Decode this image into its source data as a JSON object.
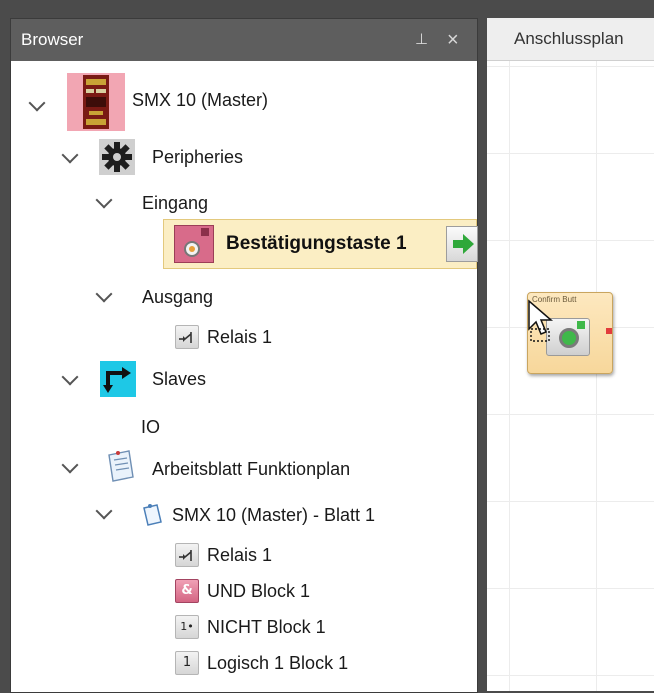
{
  "browser": {
    "title": "Browser",
    "pin_glyph": "⊥",
    "close_glyph": "×"
  },
  "tree": {
    "master": "SMX 10 (Master)",
    "peripheries": "Peripheries",
    "eingang": "Eingang",
    "bestaetigungstaste": "Bestätigungstaste 1",
    "ausgang": "Ausgang",
    "relais_out": "Relais 1",
    "slaves": "Slaves",
    "io": "IO",
    "arbeitsblatt": "Arbeitsblatt Funktionplan",
    "blatt": "SMX 10 (Master) - Blatt 1",
    "relais_blatt": "Relais 1",
    "und_block": "UND Block 1",
    "und_glyph": "&",
    "nicht_block": "NICHT Block 1",
    "nicht_glyph": "1•",
    "logisch_block": "Logisch 1 Block 1",
    "logisch_glyph": "1"
  },
  "right_panel": {
    "tab_label": "Anschlussplan",
    "block_label": "Confirm Butt"
  },
  "colors": {
    "header_bg": "#5e5e5e",
    "selection_bg": "#fbeec4",
    "slaves_icon": "#1ec8e6",
    "master_icon": "#f2a6b3",
    "arrow_green": "#2fa83a"
  },
  "icons": {
    "master": "device-board-icon",
    "peripheries": "gear-icon",
    "button": "pushbutton-icon",
    "relay": "relay-contact-icon",
    "slaves": "slaves-arrow-icon",
    "worksheet": "worksheet-icon",
    "sheet": "sheet-icon"
  }
}
